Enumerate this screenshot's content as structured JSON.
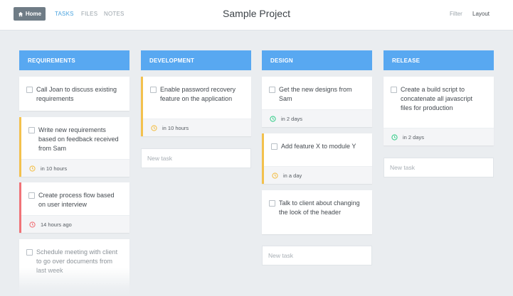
{
  "header": {
    "home_label": "Home",
    "tabs": [
      {
        "label": "TASKS",
        "active": true
      },
      {
        "label": "FILES",
        "active": false
      },
      {
        "label": "NOTES",
        "active": false
      }
    ],
    "title": "Sample Project",
    "filter_label": "Filter",
    "layout_label": "Layout"
  },
  "colors": {
    "header_blue": "#58a8f1",
    "accent_orange": "#f3c14d",
    "accent_red": "#f07378",
    "clock_green": "#3ecf8e",
    "clock_orange": "#f3c14d",
    "clock_red": "#f07378"
  },
  "columns": [
    {
      "title": "REQUIREMENTS",
      "cards": [
        {
          "text": "Call Joan to discuss existing requirements"
        },
        {
          "text": "Write new requirements based on feedback received from Sam",
          "due": "in 10 hours"
        },
        {
          "text": "Create process flow based on user interview",
          "due": "14 hours ago"
        },
        {
          "text": "Schedule meeting with client to go over documents from last week"
        }
      ]
    },
    {
      "title": "DEVELOPMENT",
      "cards": [
        {
          "text": "Enable password recovery feature on the application",
          "due": "in 10 hours"
        }
      ],
      "new_task_placeholder": "New task"
    },
    {
      "title": "DESIGN",
      "cards": [
        {
          "text": "Get the new designs from Sam",
          "due": "in 2 days"
        },
        {
          "text": "Add feature X to module Y",
          "due": "in a day"
        },
        {
          "text": "Talk to client about changing the look of the header"
        }
      ],
      "new_task_placeholder": "New task"
    },
    {
      "title": "RELEASE",
      "cards": [
        {
          "text": "Create a build script to concatenate all javascript files for production",
          "due": "in 2 days"
        }
      ],
      "new_task_placeholder": "New task"
    }
  ]
}
